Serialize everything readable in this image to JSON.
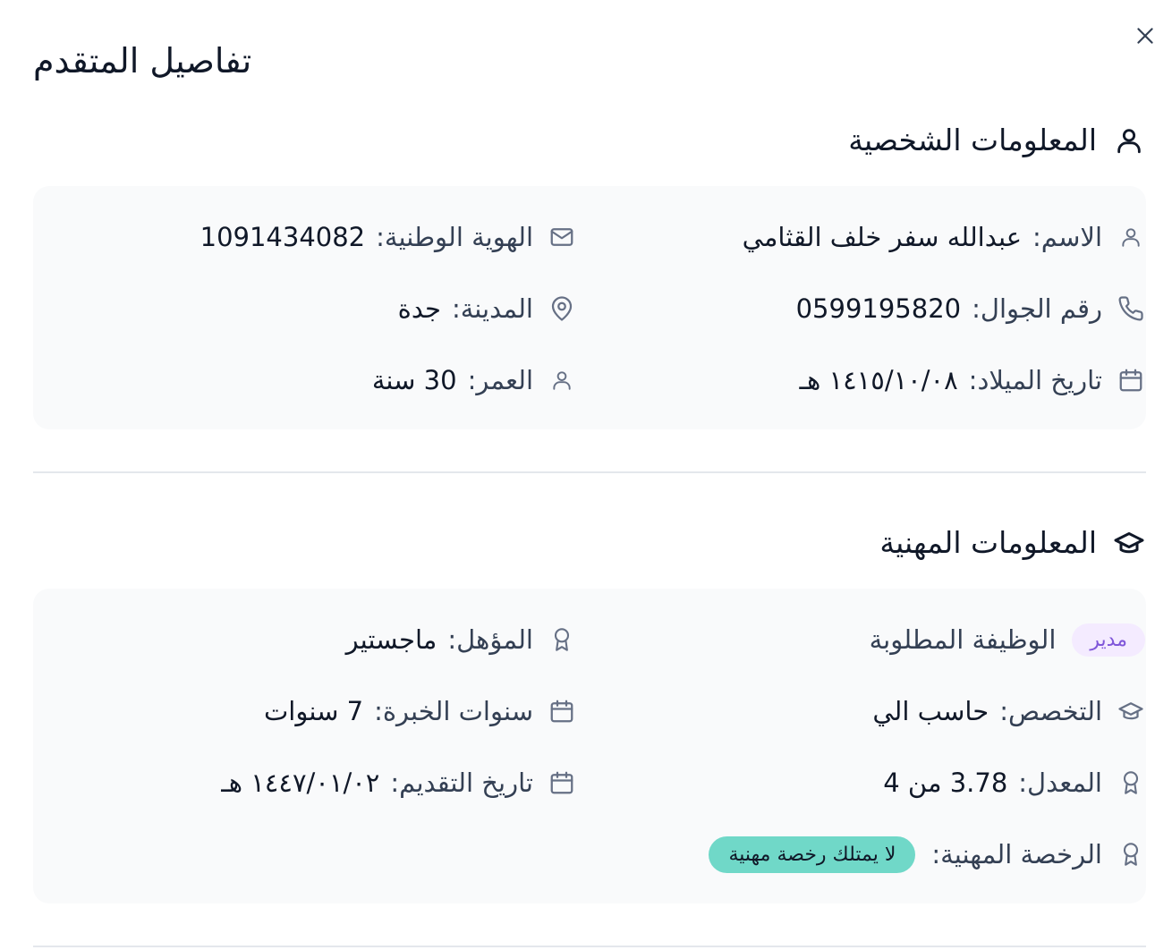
{
  "dialog": {
    "title": "تفاصيل المتقدم"
  },
  "personal": {
    "title": "المعلومات الشخصية",
    "name_label": "الاسم:",
    "name_value": "عبدالله سفر خلف القثامي",
    "id_label": "الهوية الوطنية:",
    "id_value": "1091434082",
    "phone_label": "رقم الجوال:",
    "phone_value": "0599195820",
    "city_label": "المدينة:",
    "city_value": "جدة",
    "birth_label": "تاريخ الميلاد:",
    "birth_value": "١٤١٥/١٠/٠٨ هـ",
    "age_label": "العمر:",
    "age_value": "30 سنة"
  },
  "professional": {
    "title": "المعلومات المهنية",
    "job_label": "الوظيفة المطلوبة",
    "job_value": "مدير",
    "qualification_label": "المؤهل:",
    "qualification_value": "ماجستير",
    "major_label": "التخصص:",
    "major_value": "حاسب الي",
    "experience_label": "سنوات الخبرة:",
    "experience_value": "7 سنوات",
    "gpa_label": "المعدل:",
    "gpa_value": "3.78 من 4",
    "apply_date_label": "تاريخ التقديم:",
    "apply_date_value": "١٤٤٧/٠١/٠٢ هـ",
    "license_label": "الرخصة المهنية:",
    "license_value": "لا يمتلك رخصة مهنية"
  },
  "icons": {
    "close": "close-icon",
    "user": "user-icon",
    "mail": "mail-icon",
    "phone": "phone-icon",
    "location": "map-pin-icon",
    "calendar": "calendar-icon",
    "graduation": "graduation-cap-icon",
    "award": "award-icon"
  },
  "colors": {
    "role_pill_bg": "#f4ebff",
    "role_pill_text": "#7f56d9",
    "license_pill_bg": "#70d8c8",
    "card_bg": "#f9fafb"
  }
}
